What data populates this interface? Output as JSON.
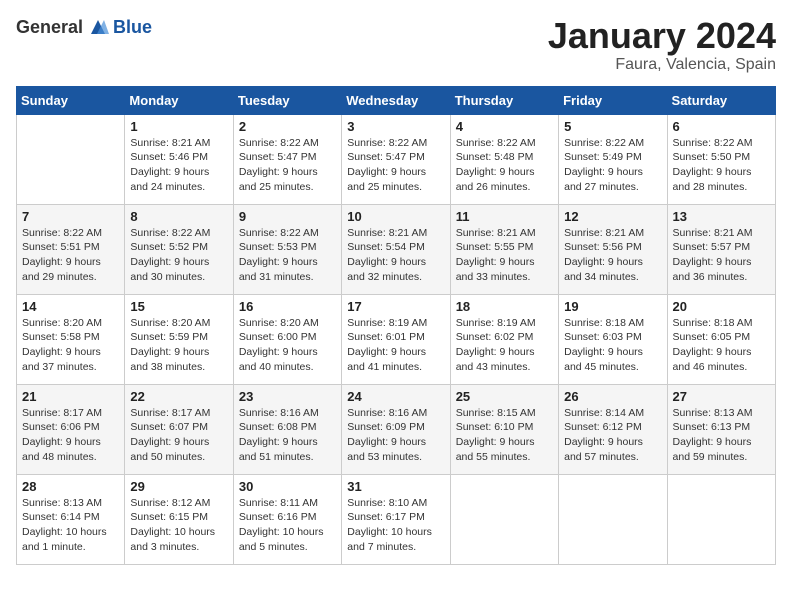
{
  "header": {
    "logo_general": "General",
    "logo_blue": "Blue",
    "month_title": "January 2024",
    "location": "Faura, Valencia, Spain"
  },
  "weekdays": [
    "Sunday",
    "Monday",
    "Tuesday",
    "Wednesday",
    "Thursday",
    "Friday",
    "Saturday"
  ],
  "weeks": [
    [
      {
        "day": "",
        "info": ""
      },
      {
        "day": "1",
        "info": "Sunrise: 8:21 AM\nSunset: 5:46 PM\nDaylight: 9 hours\nand 24 minutes."
      },
      {
        "day": "2",
        "info": "Sunrise: 8:22 AM\nSunset: 5:47 PM\nDaylight: 9 hours\nand 25 minutes."
      },
      {
        "day": "3",
        "info": "Sunrise: 8:22 AM\nSunset: 5:47 PM\nDaylight: 9 hours\nand 25 minutes."
      },
      {
        "day": "4",
        "info": "Sunrise: 8:22 AM\nSunset: 5:48 PM\nDaylight: 9 hours\nand 26 minutes."
      },
      {
        "day": "5",
        "info": "Sunrise: 8:22 AM\nSunset: 5:49 PM\nDaylight: 9 hours\nand 27 minutes."
      },
      {
        "day": "6",
        "info": "Sunrise: 8:22 AM\nSunset: 5:50 PM\nDaylight: 9 hours\nand 28 minutes."
      }
    ],
    [
      {
        "day": "7",
        "info": "Sunrise: 8:22 AM\nSunset: 5:51 PM\nDaylight: 9 hours\nand 29 minutes."
      },
      {
        "day": "8",
        "info": "Sunrise: 8:22 AM\nSunset: 5:52 PM\nDaylight: 9 hours\nand 30 minutes."
      },
      {
        "day": "9",
        "info": "Sunrise: 8:22 AM\nSunset: 5:53 PM\nDaylight: 9 hours\nand 31 minutes."
      },
      {
        "day": "10",
        "info": "Sunrise: 8:21 AM\nSunset: 5:54 PM\nDaylight: 9 hours\nand 32 minutes."
      },
      {
        "day": "11",
        "info": "Sunrise: 8:21 AM\nSunset: 5:55 PM\nDaylight: 9 hours\nand 33 minutes."
      },
      {
        "day": "12",
        "info": "Sunrise: 8:21 AM\nSunset: 5:56 PM\nDaylight: 9 hours\nand 34 minutes."
      },
      {
        "day": "13",
        "info": "Sunrise: 8:21 AM\nSunset: 5:57 PM\nDaylight: 9 hours\nand 36 minutes."
      }
    ],
    [
      {
        "day": "14",
        "info": "Sunrise: 8:20 AM\nSunset: 5:58 PM\nDaylight: 9 hours\nand 37 minutes."
      },
      {
        "day": "15",
        "info": "Sunrise: 8:20 AM\nSunset: 5:59 PM\nDaylight: 9 hours\nand 38 minutes."
      },
      {
        "day": "16",
        "info": "Sunrise: 8:20 AM\nSunset: 6:00 PM\nDaylight: 9 hours\nand 40 minutes."
      },
      {
        "day": "17",
        "info": "Sunrise: 8:19 AM\nSunset: 6:01 PM\nDaylight: 9 hours\nand 41 minutes."
      },
      {
        "day": "18",
        "info": "Sunrise: 8:19 AM\nSunset: 6:02 PM\nDaylight: 9 hours\nand 43 minutes."
      },
      {
        "day": "19",
        "info": "Sunrise: 8:18 AM\nSunset: 6:03 PM\nDaylight: 9 hours\nand 45 minutes."
      },
      {
        "day": "20",
        "info": "Sunrise: 8:18 AM\nSunset: 6:05 PM\nDaylight: 9 hours\nand 46 minutes."
      }
    ],
    [
      {
        "day": "21",
        "info": "Sunrise: 8:17 AM\nSunset: 6:06 PM\nDaylight: 9 hours\nand 48 minutes."
      },
      {
        "day": "22",
        "info": "Sunrise: 8:17 AM\nSunset: 6:07 PM\nDaylight: 9 hours\nand 50 minutes."
      },
      {
        "day": "23",
        "info": "Sunrise: 8:16 AM\nSunset: 6:08 PM\nDaylight: 9 hours\nand 51 minutes."
      },
      {
        "day": "24",
        "info": "Sunrise: 8:16 AM\nSunset: 6:09 PM\nDaylight: 9 hours\nand 53 minutes."
      },
      {
        "day": "25",
        "info": "Sunrise: 8:15 AM\nSunset: 6:10 PM\nDaylight: 9 hours\nand 55 minutes."
      },
      {
        "day": "26",
        "info": "Sunrise: 8:14 AM\nSunset: 6:12 PM\nDaylight: 9 hours\nand 57 minutes."
      },
      {
        "day": "27",
        "info": "Sunrise: 8:13 AM\nSunset: 6:13 PM\nDaylight: 9 hours\nand 59 minutes."
      }
    ],
    [
      {
        "day": "28",
        "info": "Sunrise: 8:13 AM\nSunset: 6:14 PM\nDaylight: 10 hours\nand 1 minute."
      },
      {
        "day": "29",
        "info": "Sunrise: 8:12 AM\nSunset: 6:15 PM\nDaylight: 10 hours\nand 3 minutes."
      },
      {
        "day": "30",
        "info": "Sunrise: 8:11 AM\nSunset: 6:16 PM\nDaylight: 10 hours\nand 5 minutes."
      },
      {
        "day": "31",
        "info": "Sunrise: 8:10 AM\nSunset: 6:17 PM\nDaylight: 10 hours\nand 7 minutes."
      },
      {
        "day": "",
        "info": ""
      },
      {
        "day": "",
        "info": ""
      },
      {
        "day": "",
        "info": ""
      }
    ]
  ]
}
